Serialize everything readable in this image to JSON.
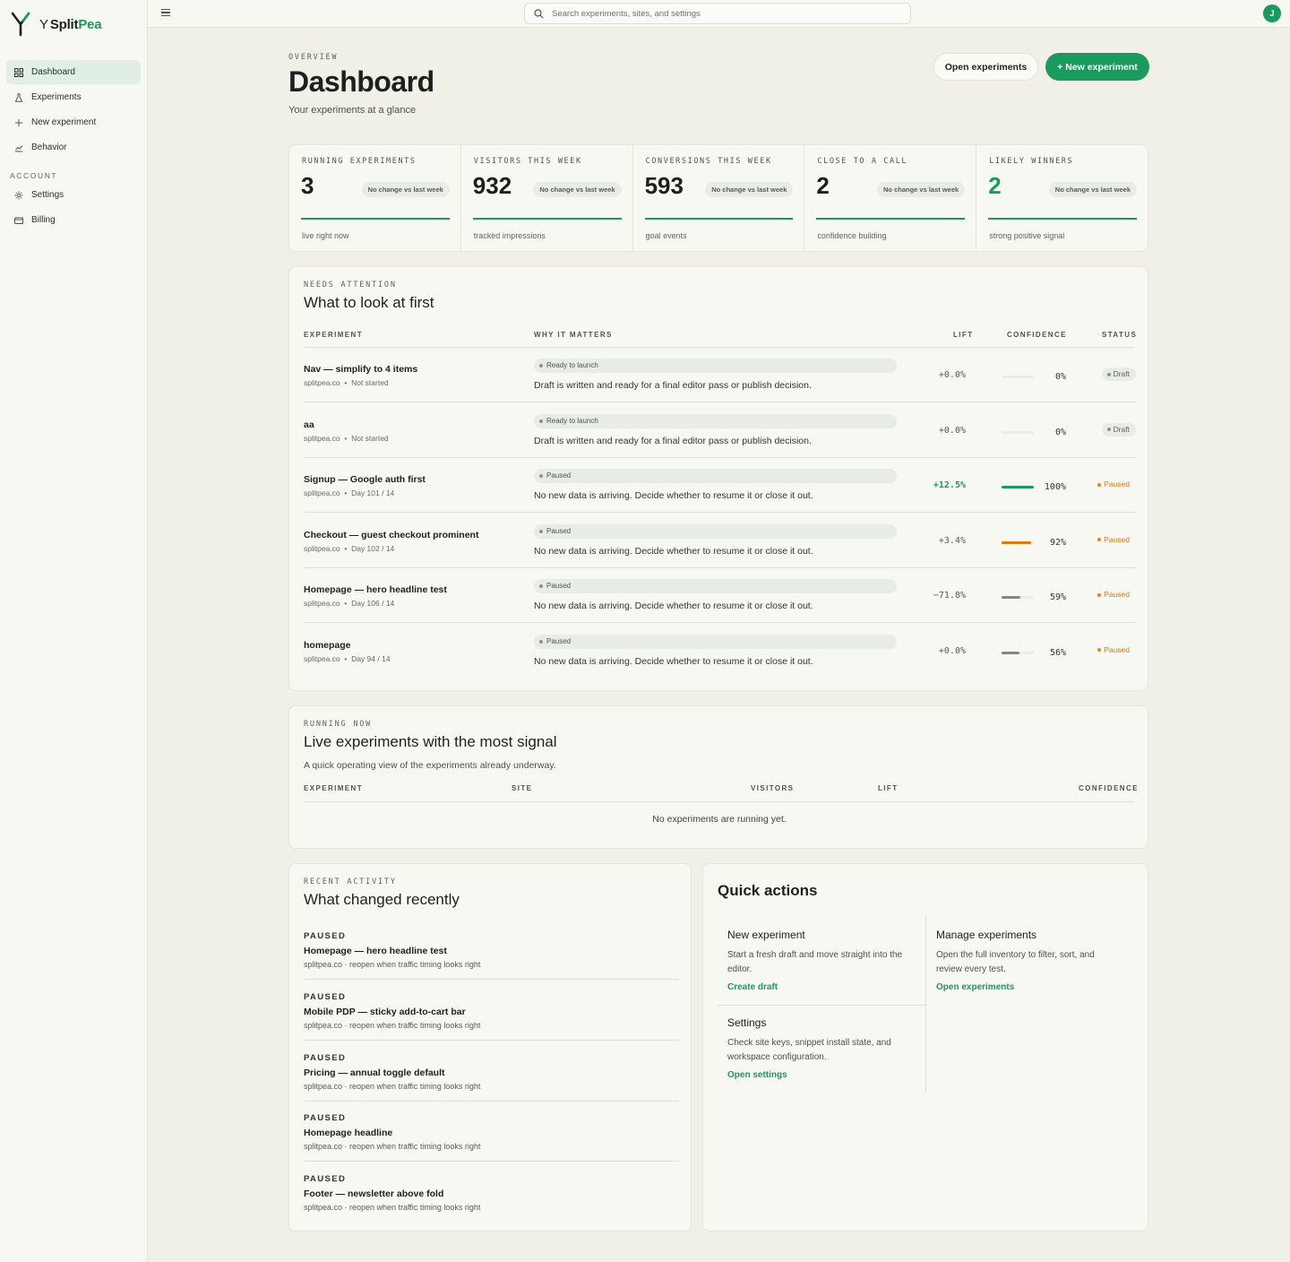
{
  "brand": {
    "prefix": "Y",
    "name_a": "Split",
    "name_b": "Pea"
  },
  "sidebar": {
    "items": [
      {
        "label": "Dashboard",
        "icon": "grid-icon",
        "active": true
      },
      {
        "label": "Experiments",
        "icon": "flask-icon"
      },
      {
        "label": "New experiment",
        "icon": "plus-icon"
      },
      {
        "label": "Behavior",
        "icon": "chart-icon"
      }
    ],
    "account_title": "ACCOUNT",
    "account_items": [
      {
        "label": "Settings",
        "icon": "gear-icon"
      },
      {
        "label": "Billing",
        "icon": "card-icon"
      }
    ]
  },
  "topbar": {
    "search_placeholder": "Search experiments, sites, and settings",
    "avatar_initial": "J"
  },
  "header": {
    "eyebrow": "OVERVIEW",
    "title": "Dashboard",
    "subtitle": "Your experiments at a glance",
    "open_button": "Open experiments",
    "new_button": "+ New experiment"
  },
  "stats": [
    {
      "label": "RUNNING EXPERIMENTS",
      "value": "3",
      "badge": "No change vs last week",
      "foot": "live right now"
    },
    {
      "label": "VISITORS THIS WEEK",
      "value": "932",
      "badge": "No change vs last week",
      "foot": "tracked impressions"
    },
    {
      "label": "CONVERSIONS THIS WEEK",
      "value": "593",
      "badge": "No change vs last week",
      "foot": "goal events"
    },
    {
      "label": "CLOSE TO A CALL",
      "value": "2",
      "badge": "No change vs last week",
      "foot": "confidence building"
    },
    {
      "label": "LIKELY WINNERS",
      "value": "2",
      "badge": "No change vs last week",
      "foot": "strong positive signal",
      "highlight": true
    }
  ],
  "attention": {
    "eyebrow": "NEEDS ATTENTION",
    "title": "What to look at first",
    "columns": [
      "EXPERIMENT",
      "WHY IT MATTERS",
      "LIFT",
      "CONFIDENCE",
      "STATUS"
    ],
    "rows": [
      {
        "name": "Nav — simplify to 4 items",
        "site": "splitpea.co",
        "progress": "Not started",
        "reason": "Ready to launch",
        "detail": "Draft is written and ready for a final editor pass or publish decision.",
        "lift": "+0.0%",
        "confidence": 0,
        "confidence_label": "0%",
        "status": "Draft",
        "bar_color": "#d0d4cf"
      },
      {
        "name": "aa",
        "site": "splitpea.co",
        "progress": "Not started",
        "reason": "Ready to launch",
        "detail": "Draft is written and ready for a final editor pass or publish decision.",
        "lift": "+0.0%",
        "confidence": 0,
        "confidence_label": "0%",
        "status": "Draft",
        "bar_color": "#d0d4cf"
      },
      {
        "name": "Signup — Google auth first",
        "site": "splitpea.co",
        "progress": "Day 101 / 14",
        "reason": "Paused",
        "detail": "No new data is arriving. Decide whether to resume it or close it out.",
        "lift": "+12.5%",
        "lift_positive": true,
        "confidence": 100,
        "confidence_label": "100%",
        "status": "Paused",
        "bar_color": "#1a9a5c"
      },
      {
        "name": "Checkout — guest checkout prominent",
        "site": "splitpea.co",
        "progress": "Day 102 / 14",
        "reason": "Paused",
        "detail": "No new data is arriving. Decide whether to resume it or close it out.",
        "lift": "+3.4%",
        "confidence": 92,
        "confidence_label": "92%",
        "status": "Paused",
        "bar_color": "#e27a14"
      },
      {
        "name": "Homepage — hero headline test",
        "site": "splitpea.co",
        "progress": "Day 106 / 14",
        "reason": "Paused",
        "detail": "No new data is arriving. Decide whether to resume it or close it out.",
        "lift": "−71.8%",
        "confidence": 59,
        "confidence_label": "59%",
        "status": "Paused",
        "bar_color": "#7f8882"
      },
      {
        "name": "homepage",
        "site": "splitpea.co",
        "progress": "Day 94 / 14",
        "reason": "Paused",
        "detail": "No new data is arriving. Decide whether to resume it or close it out.",
        "lift": "+0.0%",
        "confidence": 56,
        "confidence_label": "56%",
        "status": "Paused",
        "bar_color": "#7f8882"
      }
    ]
  },
  "running": {
    "eyebrow": "RUNNING NOW",
    "title": "Live experiments with the most signal",
    "subtitle": "A quick operating view of the experiments already underway.",
    "columns": [
      "EXPERIMENT",
      "SITE",
      "VISITORS",
      "LIFT",
      "CONFIDENCE"
    ],
    "empty": "No experiments are running yet."
  },
  "activity": {
    "eyebrow": "RECENT ACTIVITY",
    "title": "What changed recently",
    "items": [
      {
        "kind": "PAUSED",
        "title": "Homepage — hero headline test",
        "meta": "splitpea.co · reopen when traffic timing looks right"
      },
      {
        "kind": "PAUSED",
        "title": "Mobile PDP — sticky add-to-cart bar",
        "meta": "splitpea.co · reopen when traffic timing looks right"
      },
      {
        "kind": "PAUSED",
        "title": "Pricing — annual toggle default",
        "meta": "splitpea.co · reopen when traffic timing looks right"
      },
      {
        "kind": "PAUSED",
        "title": "Homepage headline",
        "meta": "splitpea.co · reopen when traffic timing looks right"
      },
      {
        "kind": "PAUSED",
        "title": "Footer — newsletter above fold",
        "meta": "splitpea.co · reopen when traffic timing looks right"
      }
    ]
  },
  "quick": {
    "title": "Quick actions",
    "new": {
      "title": "New experiment",
      "desc": "Start a fresh draft and move straight into the editor.",
      "link": "Create draft"
    },
    "manage": {
      "title": "Manage experiments",
      "desc": "Open the full inventory to filter, sort, and review every test.",
      "link": "Open experiments"
    },
    "settings": {
      "title": "Settings",
      "desc": "Check site keys, snippet install state, and workspace configuration.",
      "link": "Open settings"
    }
  },
  "colors": {
    "accent": "#1a9a5c",
    "paused": "#d97512",
    "background": "#f1f0e7"
  }
}
